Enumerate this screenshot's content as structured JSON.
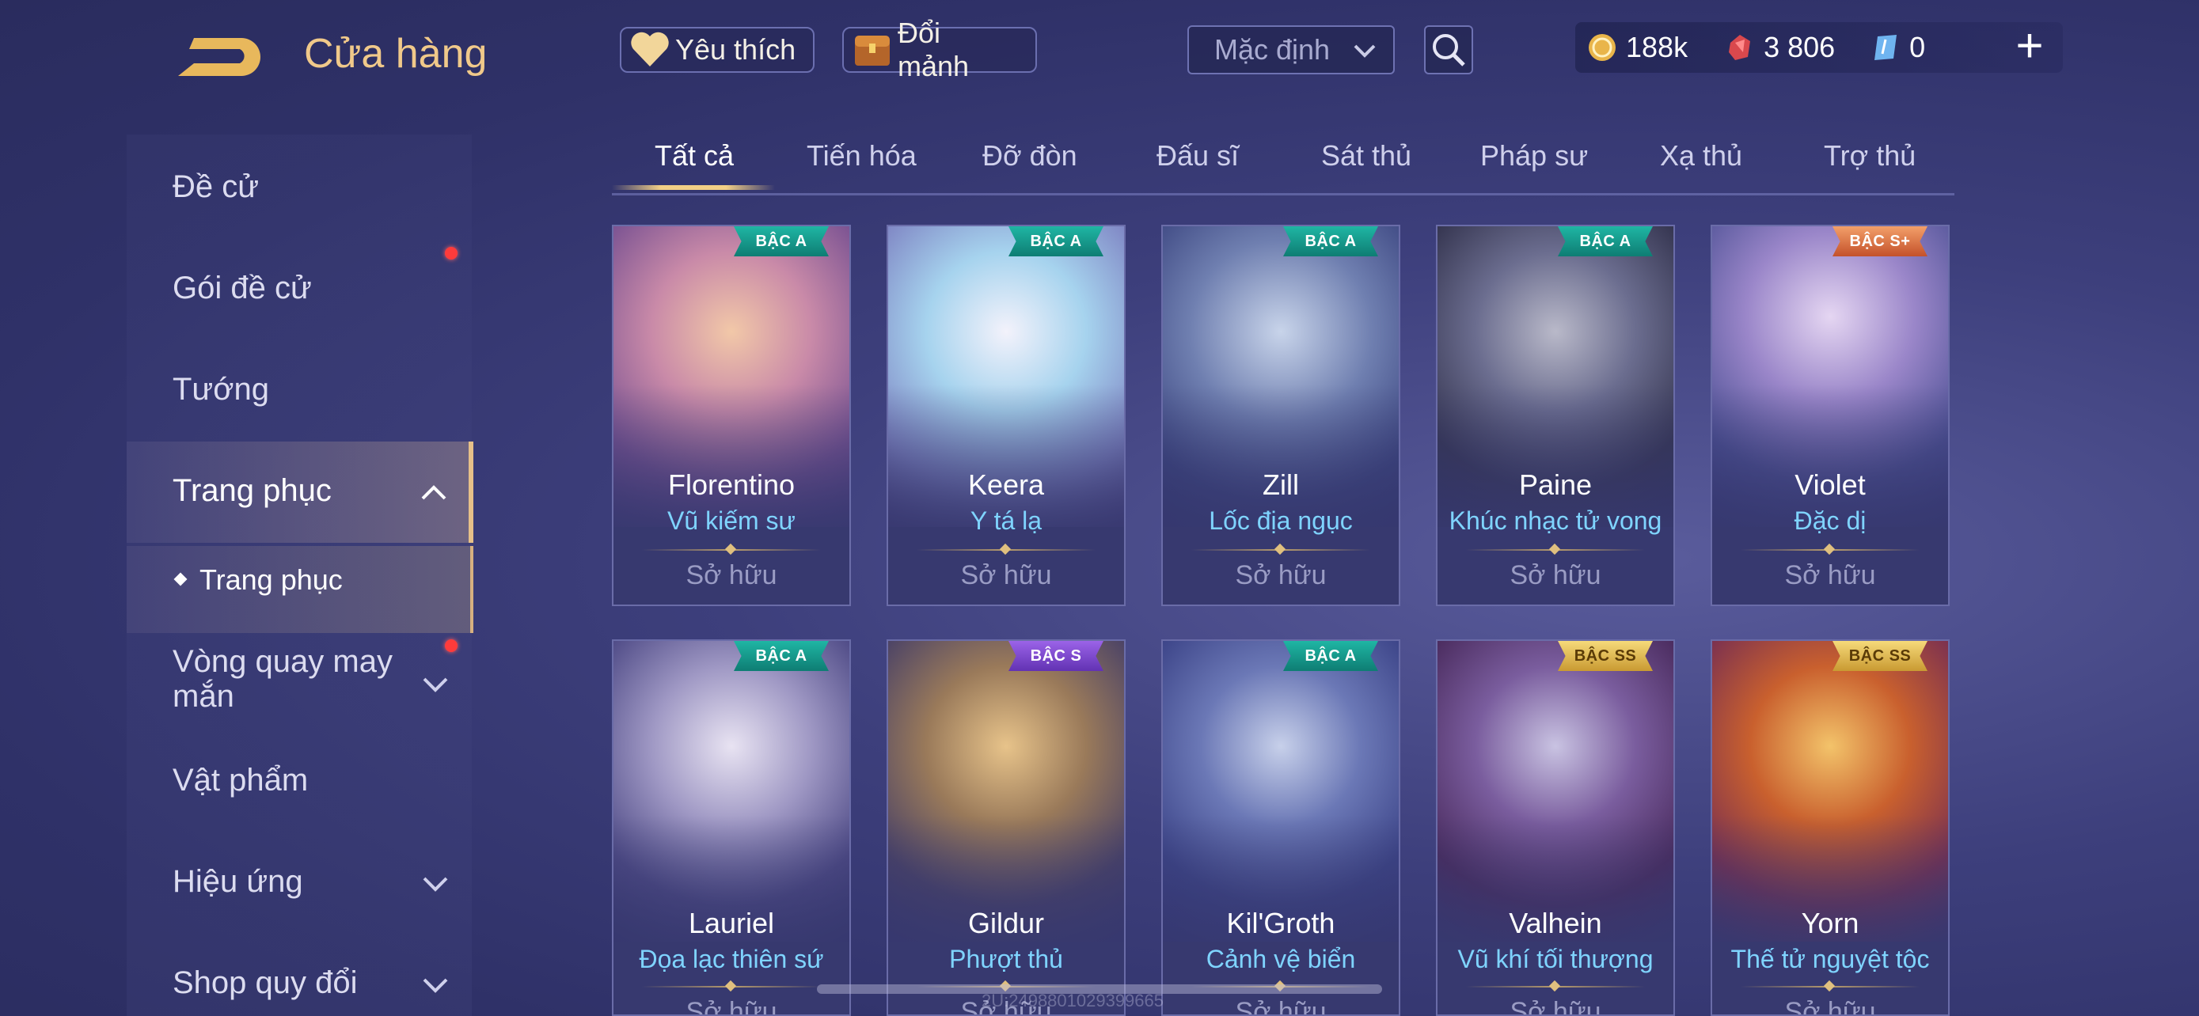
{
  "header": {
    "title": "Cửa hàng",
    "favorites_label": "Yêu thích",
    "exchange_label": "Đổi mảnh",
    "sort_value": "Mặc định",
    "currencies": [
      {
        "icon": "gold-coin-icon",
        "value": "188k"
      },
      {
        "icon": "red-gem-icon",
        "value": "3 806"
      },
      {
        "icon": "blue-voucher-icon",
        "value": "0"
      }
    ]
  },
  "sidebar": {
    "items": [
      {
        "label": "Đề cử"
      },
      {
        "label": "Gói đề cử"
      },
      {
        "label": "Tướng"
      },
      {
        "label": "Trang phục"
      },
      {
        "label": "Trang phục"
      },
      {
        "label": "Vòng quay may mắn"
      },
      {
        "label": "Vật phẩm"
      },
      {
        "label": "Hiệu ứng"
      },
      {
        "label": "Shop quy đổi"
      }
    ]
  },
  "tabs": [
    "Tất cả",
    "Tiến hóa",
    "Đỡ đòn",
    "Đấu sĩ",
    "Sát thủ",
    "Pháp sư",
    "Xạ thủ",
    "Trợ thủ"
  ],
  "owned_label": "Sở hữu",
  "cards": [
    {
      "hero": "Florentino",
      "skin": "Vũ kiếm sư",
      "tier": "BẬC A"
    },
    {
      "hero": "Keera",
      "skin": "Y tá lạ",
      "tier": "BẬC A"
    },
    {
      "hero": "Zill",
      "skin": "Lốc địa ngục",
      "tier": "BẬC A"
    },
    {
      "hero": "Paine",
      "skin": "Khúc nhạc tử vong",
      "tier": "BẬC A"
    },
    {
      "hero": "Violet",
      "skin": "Đặc dị",
      "tier": "BẬC S+"
    },
    {
      "hero": "Lauriel",
      "skin": "Đọa lạc thiên sứ",
      "tier": "BẬC A"
    },
    {
      "hero": "Gildur",
      "skin": "Phượt thủ",
      "tier": "BẬC S"
    },
    {
      "hero": "Kil'Groth",
      "skin": "Cảnh vệ biển",
      "tier": "BẬC A"
    },
    {
      "hero": "Valhein",
      "skin": "Vũ khí tối thượng",
      "tier": "BẬC SS"
    },
    {
      "hero": "Yorn",
      "skin": "Thế tử nguyệt tộc",
      "tier": "BẬC SS"
    }
  ],
  "footer_id": "2U:2498801029399665",
  "colors": {
    "accent": "#f0c98a",
    "skin_text": "#7fd4ff",
    "notification": "#ff3b3b"
  }
}
